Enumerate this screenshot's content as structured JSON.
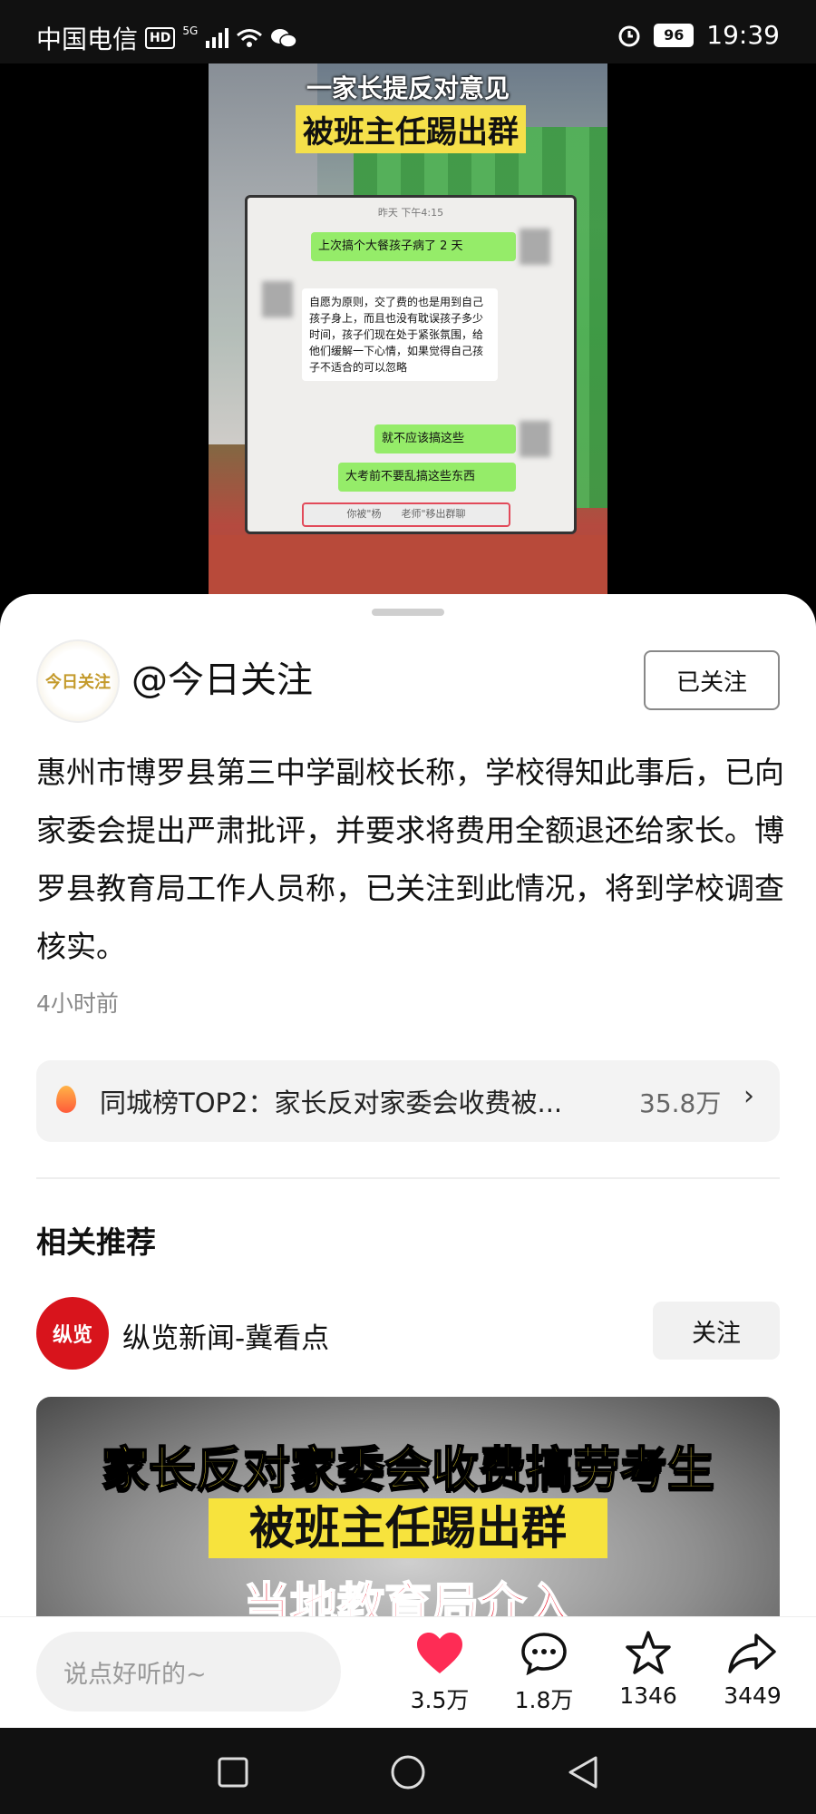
{
  "status_bar": {
    "carrier": "中国电信",
    "hd": "HD",
    "network": "5G",
    "battery": "96",
    "time": "19:39"
  },
  "video": {
    "overlay_line1": "一家长提反对意见",
    "overlay_line2": "被班主任踢出群",
    "chat_time": "昨天 下午4:15",
    "msg1": "上次搞个大餐孩子病了 2 天",
    "msg2": "自愿为原则，交了费的也是用到自己孩子身上，而且也没有耽误孩子多少时间，孩子们现在处于紧张氛围，给他们缓解一下心情，如果觉得自己孩子不适合的可以忽略",
    "msg3": "就不应该搞这些",
    "msg4": "大考前不要乱搞这些东西",
    "system_msg": "你被\"杨　　老师\"移出群聊"
  },
  "post": {
    "avatar_text": "今日关注",
    "author": "@今日关注",
    "follow_state": "已关注",
    "body": "惠州市博罗县第三中学副校长称，学校得知此事后，已向家委会提出严肃批评，并要求将费用全额退还给家长。博罗县教育局工作人员称，已关注到此情况，将到学校调查核实。",
    "time_ago": "4小时前"
  },
  "ranking": {
    "text": "同城榜TOP2：家长反对家委会收费被...",
    "count": "35.8万"
  },
  "related": {
    "title": "相关推荐",
    "avatar_text": "纵览",
    "name": "纵览新闻-冀看点",
    "follow_label": "关注",
    "video_line1": "家长反对家委会收费搞劳考生",
    "video_line2": "被班主任踢出群",
    "video_line3": "当地教育局介入"
  },
  "bottom": {
    "comment_placeholder": "说点好听的~",
    "likes": "3.5万",
    "comments": "1.8万",
    "favorites": "1346",
    "shares": "3449"
  },
  "colors": {
    "like_red": "#fe2c55",
    "brand_red": "#d8141c"
  }
}
